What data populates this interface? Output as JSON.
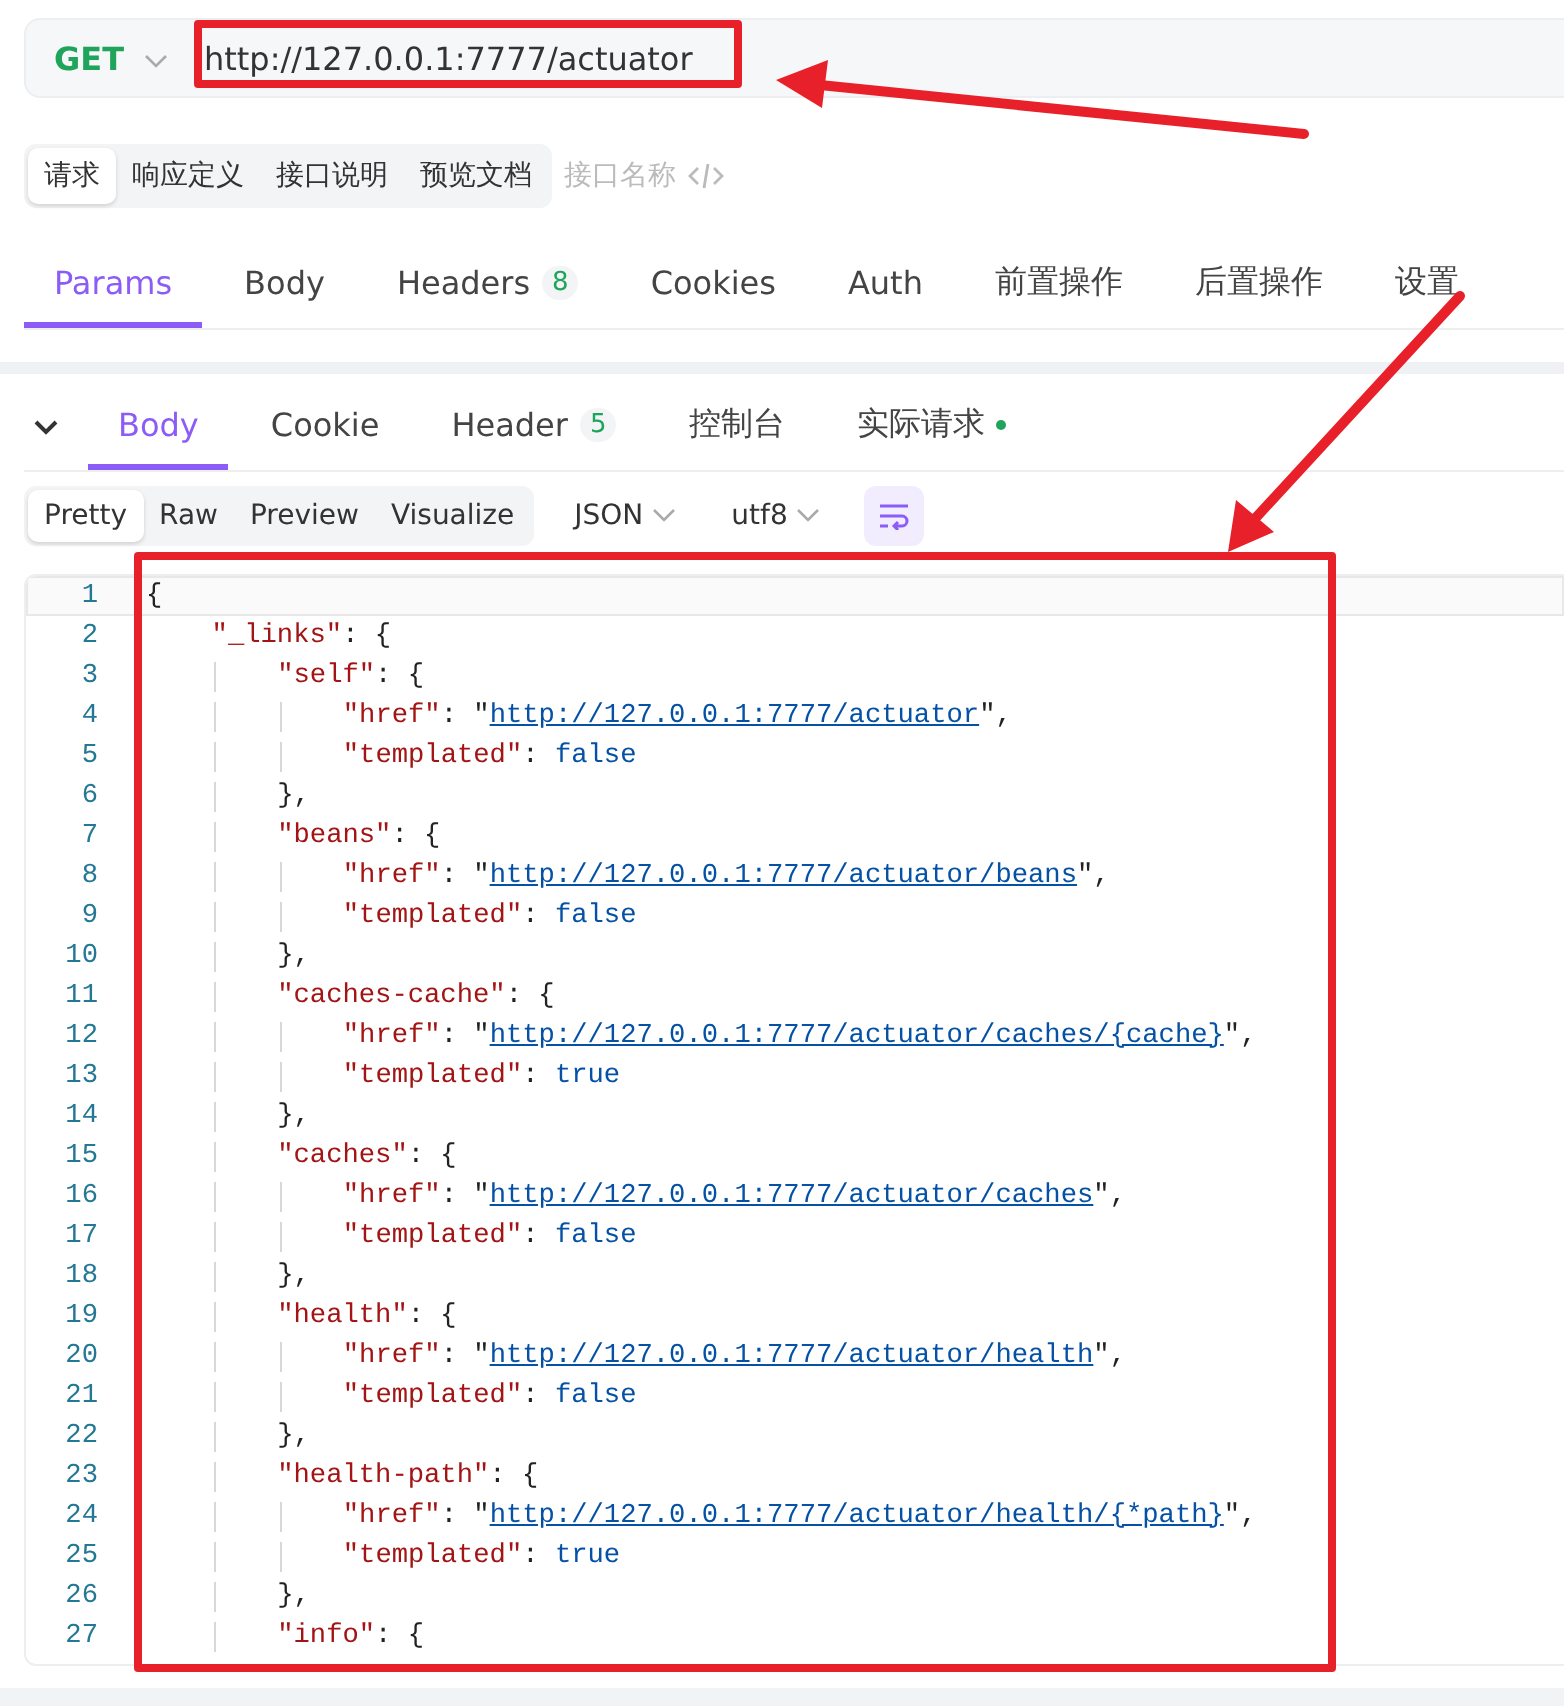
{
  "request_bar": {
    "method": "GET",
    "url": "http://127.0.0.1:7777/actuator"
  },
  "mode_tabs": [
    {
      "label": "请求",
      "selected": true
    },
    {
      "label": "响应定义",
      "selected": false
    },
    {
      "label": "接口说明",
      "selected": false
    },
    {
      "label": "预览文档",
      "selected": false
    }
  ],
  "name_placeholder": "接口名称",
  "request_tabs": [
    {
      "label": "Params",
      "selected": true
    },
    {
      "label": "Body",
      "selected": false
    },
    {
      "label": "Headers",
      "selected": false,
      "count": "8"
    },
    {
      "label": "Cookies",
      "selected": false
    },
    {
      "label": "Auth",
      "selected": false
    },
    {
      "label": "前置操作",
      "selected": false
    },
    {
      "label": "后置操作",
      "selected": false
    },
    {
      "label": "设置",
      "selected": false
    }
  ],
  "response_tabs": [
    {
      "label": "Body",
      "selected": true
    },
    {
      "label": "Cookie",
      "selected": false
    },
    {
      "label": "Header",
      "selected": false,
      "count": "5"
    },
    {
      "label": "控制台",
      "selected": false
    },
    {
      "label": "实际请求",
      "selected": false,
      "dot": true
    }
  ],
  "view_tabs": [
    {
      "label": "Pretty",
      "selected": true
    },
    {
      "label": "Raw",
      "selected": false
    },
    {
      "label": "Preview",
      "selected": false
    },
    {
      "label": "Visualize",
      "selected": false
    }
  ],
  "format_select": "JSON",
  "encoding_select": "utf8",
  "code_lines": [
    {
      "number": "1",
      "tokens": [
        {
          "kind": "punct",
          "text": "{"
        }
      ],
      "children": [
        {
          "number": "2",
          "tokens": [
            {
              "kind": "key",
              "text": "\"_links\""
            },
            {
              "kind": "punct",
              "text": ": {"
            }
          ],
          "children": [
            {
              "number": "3",
              "tokens": [
                {
                  "kind": "key",
                  "text": "\"self\""
                },
                {
                  "kind": "punct",
                  "text": ": {"
                }
              ],
              "children": [
                {
                  "number": "4",
                  "tokens": [
                    {
                      "kind": "key",
                      "text": "\"href\""
                    },
                    {
                      "kind": "punct",
                      "text": ": \""
                    },
                    {
                      "kind": "link",
                      "text": "http://127.0.0.1:7777/actuator"
                    },
                    {
                      "kind": "punct",
                      "text": "\","
                    }
                  ]
                },
                {
                  "number": "5",
                  "tokens": [
                    {
                      "kind": "key",
                      "text": "\"templated\""
                    },
                    {
                      "kind": "punct",
                      "text": ": "
                    },
                    {
                      "kind": "bool",
                      "text": "false"
                    }
                  ]
                }
              ]
            },
            {
              "number": "6",
              "tokens": [
                {
                  "kind": "punct",
                  "text": "},"
                }
              ]
            },
            {
              "number": "7",
              "tokens": [
                {
                  "kind": "key",
                  "text": "\"beans\""
                },
                {
                  "kind": "punct",
                  "text": ": {"
                }
              ],
              "children": [
                {
                  "number": "8",
                  "tokens": [
                    {
                      "kind": "key",
                      "text": "\"href\""
                    },
                    {
                      "kind": "punct",
                      "text": ": \""
                    },
                    {
                      "kind": "link",
                      "text": "http://127.0.0.1:7777/actuator/beans"
                    },
                    {
                      "kind": "punct",
                      "text": "\","
                    }
                  ]
                },
                {
                  "number": "9",
                  "tokens": [
                    {
                      "kind": "key",
                      "text": "\"templated\""
                    },
                    {
                      "kind": "punct",
                      "text": ": "
                    },
                    {
                      "kind": "bool",
                      "text": "false"
                    }
                  ]
                }
              ]
            },
            {
              "number": "10",
              "tokens": [
                {
                  "kind": "punct",
                  "text": "},"
                }
              ]
            },
            {
              "number": "11",
              "tokens": [
                {
                  "kind": "key",
                  "text": "\"caches-cache\""
                },
                {
                  "kind": "punct",
                  "text": ": {"
                }
              ],
              "children": [
                {
                  "number": "12",
                  "tokens": [
                    {
                      "kind": "key",
                      "text": "\"href\""
                    },
                    {
                      "kind": "punct",
                      "text": ": \""
                    },
                    {
                      "kind": "link",
                      "text": "http://127.0.0.1:7777/actuator/caches/{cache}"
                    },
                    {
                      "kind": "punct",
                      "text": "\","
                    }
                  ]
                },
                {
                  "number": "13",
                  "tokens": [
                    {
                      "kind": "key",
                      "text": "\"templated\""
                    },
                    {
                      "kind": "punct",
                      "text": ": "
                    },
                    {
                      "kind": "bool",
                      "text": "true"
                    }
                  ]
                }
              ]
            },
            {
              "number": "14",
              "tokens": [
                {
                  "kind": "punct",
                  "text": "},"
                }
              ]
            },
            {
              "number": "15",
              "tokens": [
                {
                  "kind": "key",
                  "text": "\"caches\""
                },
                {
                  "kind": "punct",
                  "text": ": {"
                }
              ],
              "children": [
                {
                  "number": "16",
                  "tokens": [
                    {
                      "kind": "key",
                      "text": "\"href\""
                    },
                    {
                      "kind": "punct",
                      "text": ": \""
                    },
                    {
                      "kind": "link",
                      "text": "http://127.0.0.1:7777/actuator/caches"
                    },
                    {
                      "kind": "punct",
                      "text": "\","
                    }
                  ]
                },
                {
                  "number": "17",
                  "tokens": [
                    {
                      "kind": "key",
                      "text": "\"templated\""
                    },
                    {
                      "kind": "punct",
                      "text": ": "
                    },
                    {
                      "kind": "bool",
                      "text": "false"
                    }
                  ]
                }
              ]
            },
            {
              "number": "18",
              "tokens": [
                {
                  "kind": "punct",
                  "text": "},"
                }
              ]
            },
            {
              "number": "19",
              "tokens": [
                {
                  "kind": "key",
                  "text": "\"health\""
                },
                {
                  "kind": "punct",
                  "text": ": {"
                }
              ],
              "children": [
                {
                  "number": "20",
                  "tokens": [
                    {
                      "kind": "key",
                      "text": "\"href\""
                    },
                    {
                      "kind": "punct",
                      "text": ": \""
                    },
                    {
                      "kind": "link",
                      "text": "http://127.0.0.1:7777/actuator/health"
                    },
                    {
                      "kind": "punct",
                      "text": "\","
                    }
                  ]
                },
                {
                  "number": "21",
                  "tokens": [
                    {
                      "kind": "key",
                      "text": "\"templated\""
                    },
                    {
                      "kind": "punct",
                      "text": ": "
                    },
                    {
                      "kind": "bool",
                      "text": "false"
                    }
                  ]
                }
              ]
            },
            {
              "number": "22",
              "tokens": [
                {
                  "kind": "punct",
                  "text": "},"
                }
              ]
            },
            {
              "number": "23",
              "tokens": [
                {
                  "kind": "key",
                  "text": "\"health-path\""
                },
                {
                  "kind": "punct",
                  "text": ": {"
                }
              ],
              "children": [
                {
                  "number": "24",
                  "tokens": [
                    {
                      "kind": "key",
                      "text": "\"href\""
                    },
                    {
                      "kind": "punct",
                      "text": ": \""
                    },
                    {
                      "kind": "link",
                      "text": "http://127.0.0.1:7777/actuator/health/{*path}"
                    },
                    {
                      "kind": "punct",
                      "text": "\","
                    }
                  ]
                },
                {
                  "number": "25",
                  "tokens": [
                    {
                      "kind": "key",
                      "text": "\"templated\""
                    },
                    {
                      "kind": "punct",
                      "text": ": "
                    },
                    {
                      "kind": "bool",
                      "text": "true"
                    }
                  ]
                }
              ]
            },
            {
              "number": "26",
              "tokens": [
                {
                  "kind": "punct",
                  "text": "},"
                }
              ]
            },
            {
              "number": "27",
              "tokens": [
                {
                  "kind": "key",
                  "text": "\"info\""
                },
                {
                  "kind": "punct",
                  "text": ": {"
                }
              ]
            }
          ]
        }
      ]
    }
  ]
}
